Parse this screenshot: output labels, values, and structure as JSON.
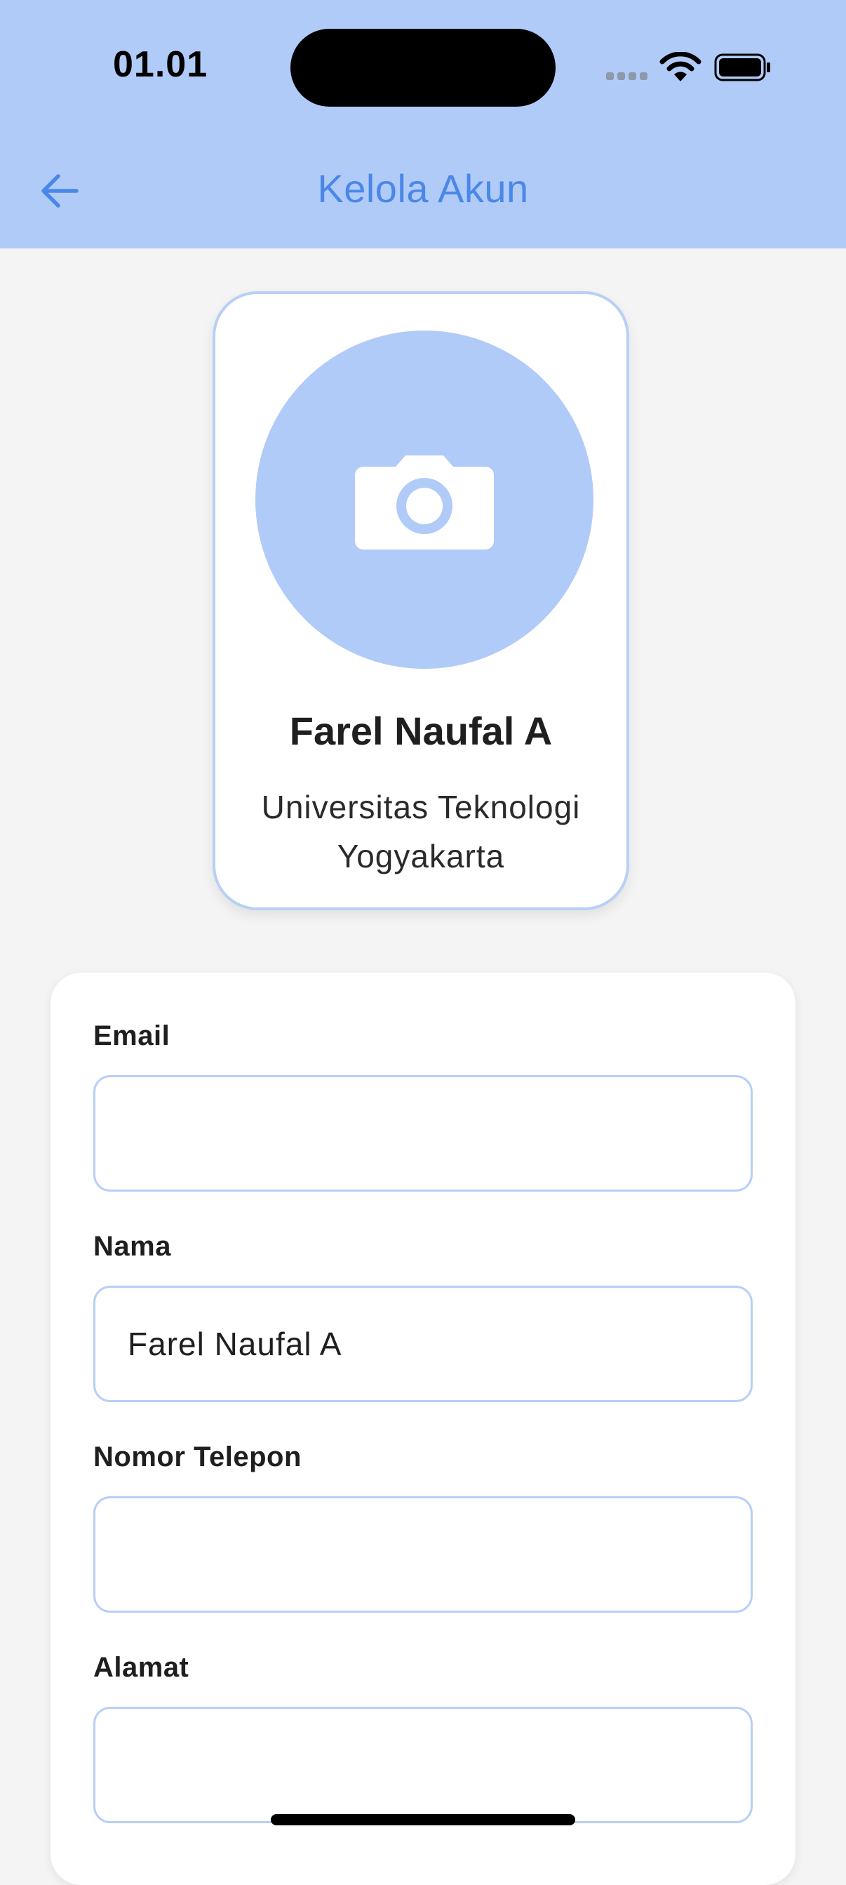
{
  "status_bar": {
    "time": "01.01"
  },
  "header": {
    "title": "Kelola Akun",
    "back_icon": "arrow-left-icon"
  },
  "profile": {
    "name": "Farel Naufal A",
    "organization": "Universitas Teknologi Yogyakarta",
    "avatar_icon": "camera-icon"
  },
  "form": {
    "email_label": "Email",
    "email_value": "",
    "name_label": "Nama",
    "name_value": "Farel Naufal A",
    "phone_label": "Nomor Telepon",
    "phone_value": "",
    "address_label": "Alamat",
    "address_value": ""
  },
  "colors": {
    "header_bg": "#b1cbf8",
    "accent": "#4a87e8",
    "input_border": "#b8cff6",
    "page_bg": "#f4f4f4"
  }
}
